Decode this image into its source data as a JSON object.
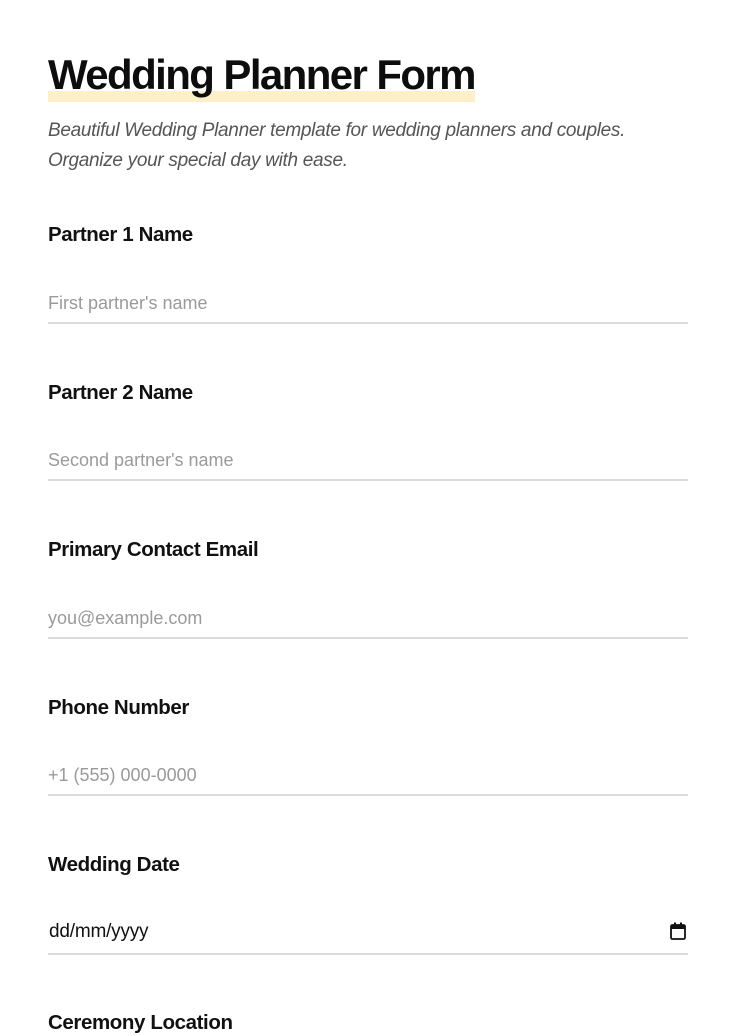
{
  "header": {
    "title": "Wedding Planner Form",
    "subtitle": "Beautiful Wedding Planner template for wedding planners and couples. Organize your special day with ease."
  },
  "fields": {
    "partner1": {
      "label": "Partner 1 Name",
      "placeholder": "First partner's name"
    },
    "partner2": {
      "label": "Partner 2 Name",
      "placeholder": "Second partner's name"
    },
    "email": {
      "label": "Primary Contact Email",
      "placeholder": "you@example.com"
    },
    "phone": {
      "label": "Phone Number",
      "placeholder": "+1 (555) 000-0000"
    },
    "wedding_date": {
      "label": "Wedding Date",
      "value": "dd/mm/yyyy",
      "icon": "calendar-icon"
    },
    "ceremony_location": {
      "label": "Ceremony Location"
    }
  },
  "colors": {
    "title_highlight": "#fdf0c8",
    "input_underline": "#dcdcdc",
    "placeholder": "#9a9a9a",
    "text": "#111111",
    "subtitle": "#555555"
  }
}
